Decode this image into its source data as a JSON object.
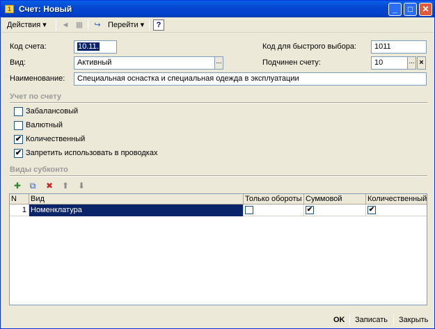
{
  "window": {
    "title": "Счет: Новый"
  },
  "toolbar": {
    "actions_label": "Действия",
    "goto_label": "Перейти",
    "help": "?"
  },
  "form": {
    "code_label": "Код счета:",
    "code_value": "10.11.",
    "kind_label": "Вид:",
    "kind_value": "Активный",
    "name_label": "Наименование:",
    "name_value": "Специальная оснастка и специальная одежда в эксплуатации",
    "quick_label": "Код для быстрого выбора:",
    "quick_value": "1011",
    "parent_label": "Подчинен счету:",
    "parent_value": "10",
    "dots": "...",
    "clear": "×"
  },
  "accounting": {
    "title": "Учет по счету",
    "items": [
      {
        "label": "Забалансовый",
        "checked": false,
        "mark": ""
      },
      {
        "label": "Валютный",
        "checked": false,
        "mark": ""
      },
      {
        "label": "Количественный",
        "checked": true,
        "mark": "✔"
      },
      {
        "label": "Запретить использовать в проводках",
        "checked": true,
        "mark": "✔"
      }
    ]
  },
  "subconto": {
    "title": "Виды субконто",
    "columns": [
      "N",
      "Вид",
      "Только обороты",
      "Суммовой",
      "Количественный"
    ],
    "rows": [
      {
        "n": "1",
        "kind": "Номенклатура",
        "turnover_only": false,
        "sum": true,
        "qty": true,
        "turnover_mark": "",
        "sum_mark": "✔",
        "qty_mark": "✔"
      }
    ]
  },
  "buttons": {
    "ok": "OK",
    "save": "Записать",
    "close": "Закрыть"
  }
}
